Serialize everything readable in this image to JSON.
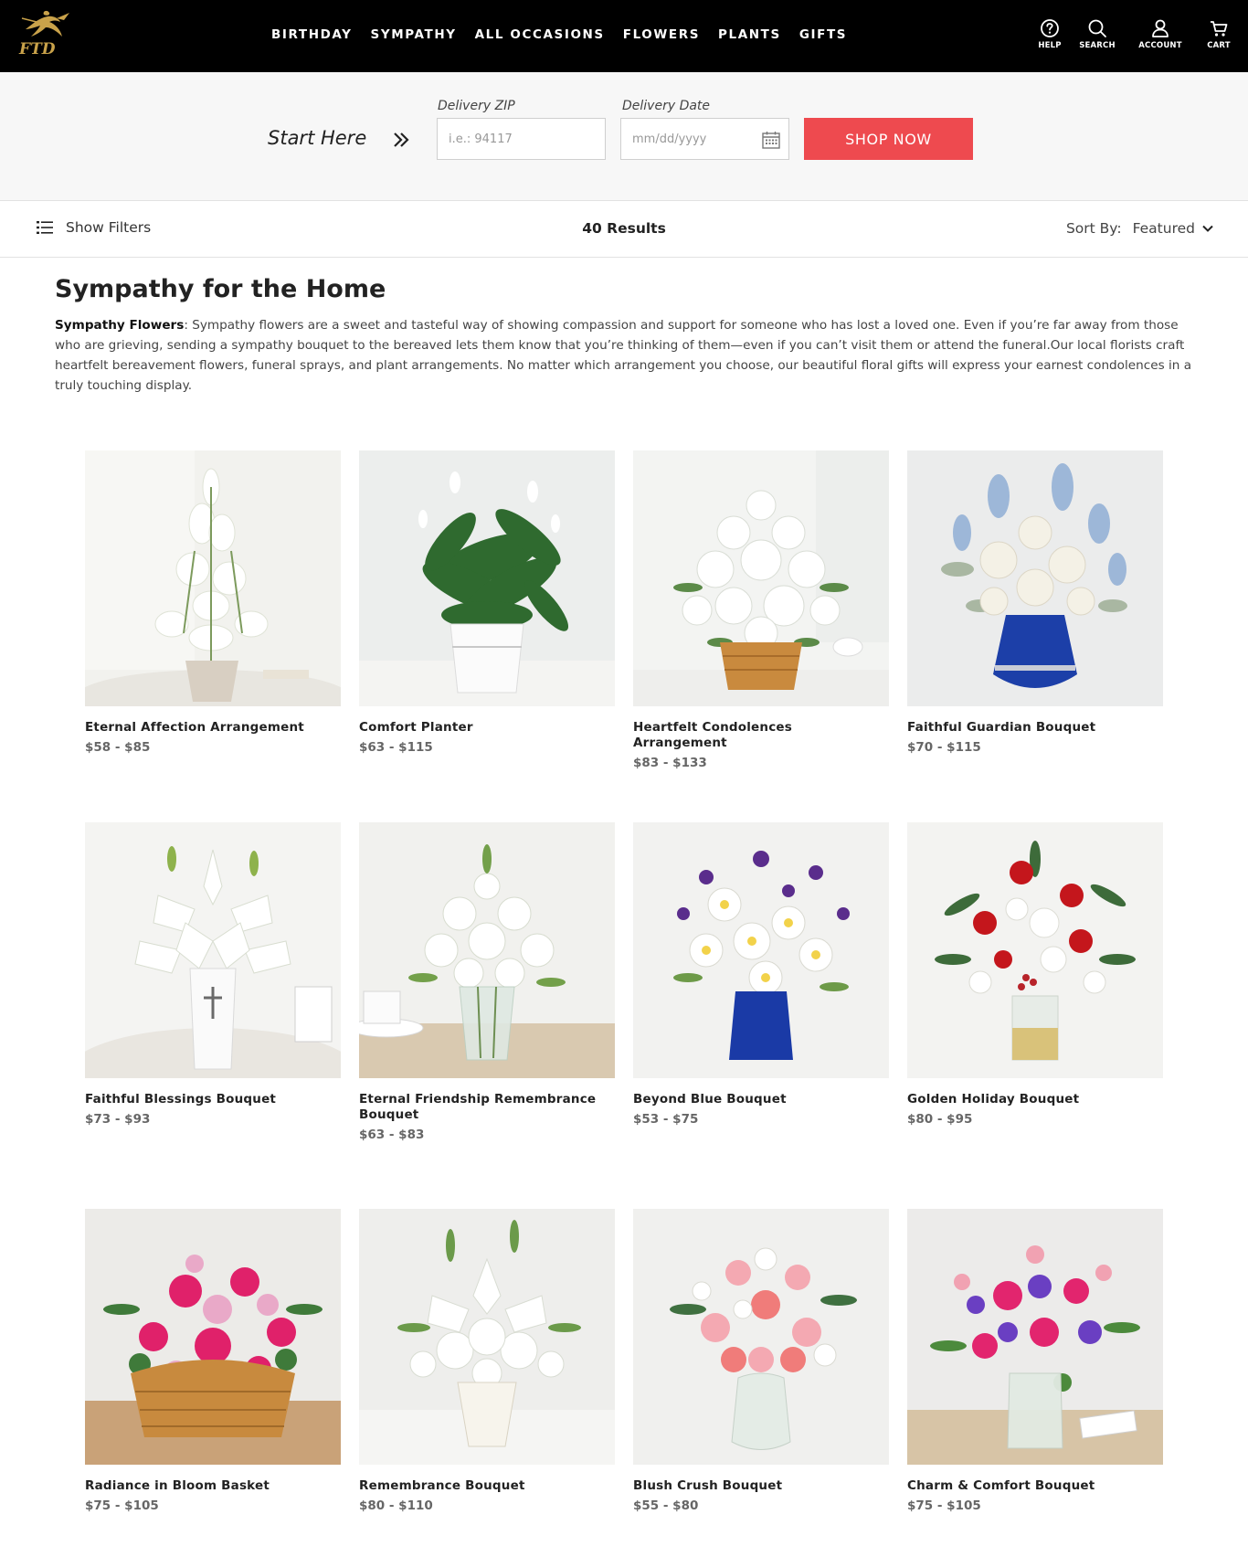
{
  "header": {
    "logo_text": "FTD",
    "nav": [
      "BIRTHDAY",
      "SYMPATHY",
      "ALL OCCASIONS",
      "FLOWERS",
      "PLANTS",
      "GIFTS"
    ],
    "utility": [
      {
        "label": "HELP",
        "icon": "help-icon"
      },
      {
        "label": "SEARCH",
        "icon": "search-icon"
      },
      {
        "label": "ACCOUNT",
        "icon": "account-icon"
      },
      {
        "label": "CART",
        "icon": "cart-icon"
      }
    ]
  },
  "delivery": {
    "start_label": "Start Here",
    "zip_label": "Delivery ZIP",
    "zip_placeholder": "i.e.: 94117",
    "zip_value": "",
    "date_label": "Delivery Date",
    "date_placeholder": "mm/dd/yyyy",
    "date_value": "",
    "shop_button": "SHOP NOW"
  },
  "filters": {
    "show_filters": "Show Filters",
    "results": "40 Results",
    "sort_label": "Sort By:",
    "sort_value": "Featured"
  },
  "page": {
    "title": "Sympathy for the Home",
    "desc_lead": "Sympathy Flowers",
    "desc_body": ": Sympathy flowers are a sweet and tasteful way of showing compassion and support for someone who has lost a loved one. Even if you’re far away from those who are grieving, sending a sympathy bouquet to the bereaved lets them know that you’re thinking of them—even if you can’t visit them or attend the funeral.Our local florists craft heartfelt bereavement flowers, funeral sprays, and plant arrangements. No matter which arrangement you choose, our beautiful floral gifts will express your earnest condolences in a truly touching display."
  },
  "products": [
    {
      "name": "Eternal Affection Arrangement",
      "price": "$58 - $85"
    },
    {
      "name": "Comfort Planter",
      "price": "$63 - $115"
    },
    {
      "name": "Heartfelt Condolences Arrangement",
      "price": "$83 - $133"
    },
    {
      "name": "Faithful Guardian Bouquet",
      "price": "$70 - $115"
    },
    {
      "name": "Faithful Blessings Bouquet",
      "price": "$73 - $93"
    },
    {
      "name": "Eternal Friendship Remembrance Bouquet",
      "price": "$63 - $83"
    },
    {
      "name": "Beyond Blue Bouquet",
      "price": "$53 - $75"
    },
    {
      "name": "Golden Holiday Bouquet",
      "price": "$80 - $95"
    },
    {
      "name": "Radiance in Bloom Basket",
      "price": "$75 - $105"
    },
    {
      "name": "Remembrance Bouquet",
      "price": "$80 - $110"
    },
    {
      "name": "Blush Crush Bouquet",
      "price": "$55 - $80"
    },
    {
      "name": "Charm & Comfort Bouquet",
      "price": "$75 - $105"
    }
  ],
  "colors": {
    "header_bg": "#000000",
    "brand_gold": "#c9a24a",
    "cta_red": "#ee4a4f",
    "band_bg": "#f7f7f7"
  }
}
